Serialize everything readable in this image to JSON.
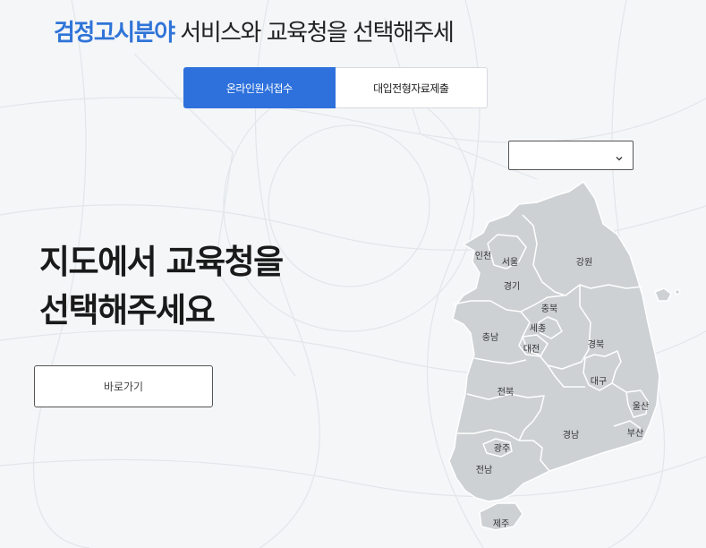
{
  "header": {
    "title_highlight": "검정고시분야",
    "title_rest": " 서비스와 교육청을 선택해주세"
  },
  "tabs": [
    {
      "label": "온라인원서접수",
      "active": true
    },
    {
      "label": "대입전형자료제출",
      "active": false
    }
  ],
  "region_select": {
    "value": "",
    "icon": "chevron-down-icon"
  },
  "headline": {
    "line1": "지도에서 교육청을 ",
    "line2": "선택해주세요"
  },
  "go_button": {
    "label": "바로가기"
  },
  "map": {
    "regions": [
      "인천",
      "서울",
      "경기",
      "강원",
      "충북",
      "세종",
      "충남",
      "대전",
      "경북",
      "대구",
      "전북",
      "울산",
      "부산",
      "경남",
      "광주",
      "전남",
      "제주"
    ]
  },
  "colors": {
    "accent": "#2e71dc",
    "region_fill": "#cdd1d4",
    "background": "#f4f6f8"
  }
}
